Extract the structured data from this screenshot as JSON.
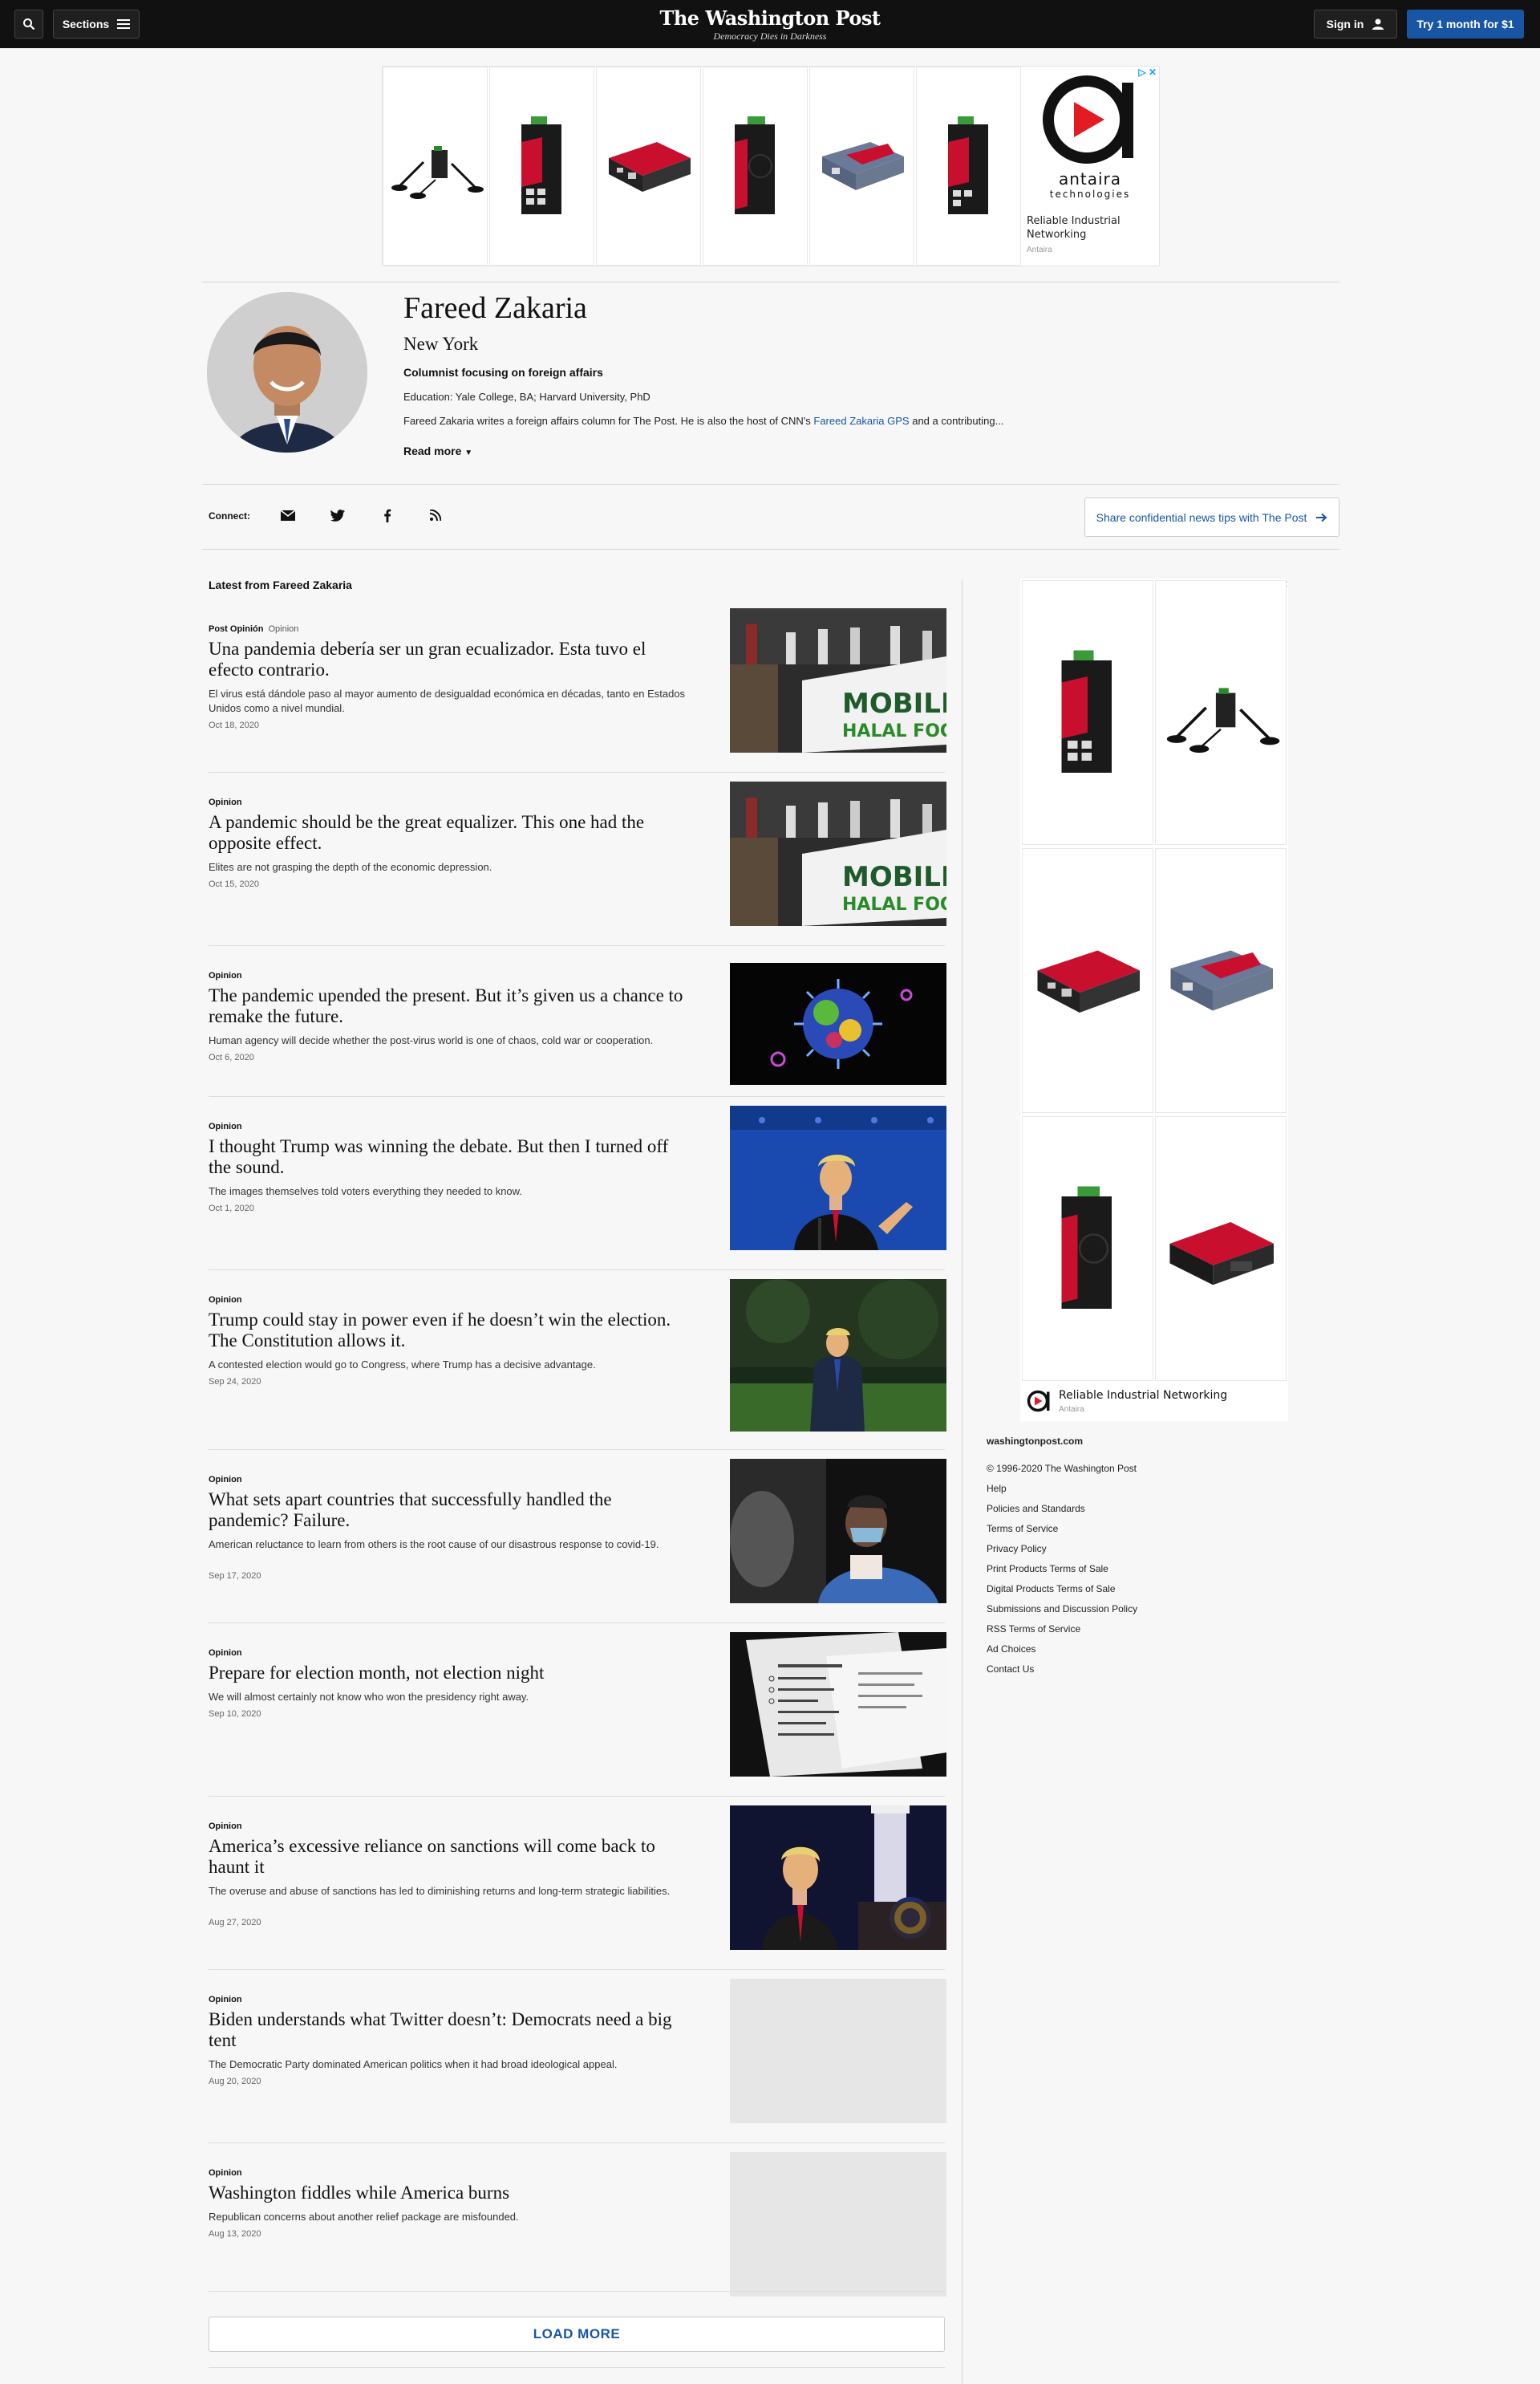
{
  "nav": {
    "sections_label": "Sections",
    "masthead": "The Washington Post",
    "tagline": "Democracy Dies in Darkness",
    "signin_label": "Sign in",
    "cta_label": "Try 1 month for $1"
  },
  "top_ad": {
    "brand_word": "antaira",
    "brand_sub": "technologies",
    "text": "Reliable Industrial Networking",
    "advertiser": "Antaira"
  },
  "profile": {
    "name": "Fareed Zakaria",
    "location": "New York",
    "role": "Columnist focusing on foreign affairs",
    "education": "Education: Yale College, BA; Harvard University, PhD",
    "bio_before": "Fareed Zakaria writes a foreign affairs column for The Post. He is also the host of CNN's ",
    "bio_link": "Fareed Zakaria GPS",
    "bio_after": " and a contributing...",
    "read_more": "Read more"
  },
  "connect": {
    "label": "Connect:",
    "tips_label": "Share confidential news tips with The Post"
  },
  "feed": {
    "title": "Latest from Fareed Zakaria",
    "articles": [
      {
        "kicker": "Post Opinión",
        "section": "Opinion",
        "headline": "Una pandemia debería ser un gran ecualizador. Esta tuvo el efecto contrario.",
        "blurb": "El virus está dándole paso al mayor aumento de desigualdad económica en décadas, tanto en Estados Unidos como a nivel mundial.",
        "date": "Oct 18, 2020"
      },
      {
        "kicker": "Opinion",
        "section": "",
        "headline": "A pandemic should be the great equalizer. This one had the opposite effect.",
        "blurb": "Elites are not grasping the depth of the economic depression.",
        "date": "Oct 15, 2020"
      },
      {
        "kicker": "Opinion",
        "section": "",
        "headline": "The pandemic upended the present. But it’s given us a chance to remake the future.",
        "blurb": "Human agency will decide whether the post-virus world is one of chaos, cold war or cooperation.",
        "date": "Oct 6, 2020"
      },
      {
        "kicker": "Opinion",
        "section": "",
        "headline": "I thought Trump was winning the debate. But then I turned off the sound.",
        "blurb": "The images themselves told voters everything they needed to know.",
        "date": "Oct 1, 2020"
      },
      {
        "kicker": "Opinion",
        "section": "",
        "headline": "Trump could stay in power even if he doesn’t win the election. The Constitution allows it.",
        "blurb": "A contested election would go to Congress, where Trump has a decisive advantage.",
        "date": "Sep 24, 2020"
      },
      {
        "kicker": "Opinion",
        "section": "",
        "headline": "What sets apart countries that successfully handled the pandemic? Failure.",
        "blurb": "American reluctance to learn from others is the root cause of our disastrous response to covid-19.",
        "date": "Sep 17, 2020"
      },
      {
        "kicker": "Opinion",
        "section": "",
        "headline": "Prepare for election month, not election night",
        "blurb": "We will almost certainly not know who won the presidency right away.",
        "date": "Sep 10, 2020"
      },
      {
        "kicker": "Opinion",
        "section": "",
        "headline": "America’s excessive reliance on sanctions will come back to haunt it",
        "blurb": "The overuse and abuse of sanctions has led to diminishing returns and long-term strategic liabilities.",
        "date": "Aug 27, 2020"
      },
      {
        "kicker": "Opinion",
        "section": "",
        "headline": "Biden understands what Twitter doesn’t: Democrats need a big tent",
        "blurb": "The Democratic Party dominated American politics when it had broad ideological appeal.",
        "date": "Aug 20, 2020"
      },
      {
        "kicker": "Opinion",
        "section": "",
        "headline": "Washington fiddles while America burns",
        "blurb": "Republican concerns about another relief package are misfounded.",
        "date": "Aug 13, 2020"
      }
    ],
    "load_more": "LOAD MORE"
  },
  "side_ad": {
    "text": "Reliable Industrial Networking",
    "advertiser": "Antaira"
  },
  "footer": {
    "site": "washingtonpost.com",
    "links": [
      "© 1996-2020 The Washington Post",
      "Help",
      "Policies and Standards",
      "Terms of Service",
      "Privacy Policy",
      "Print Products Terms of Sale",
      "Digital Products Terms of Sale",
      "Submissions and Discussion Policy",
      "RSS Terms of Service",
      "Ad Choices",
      "Contact Us"
    ]
  },
  "colors": {
    "nav_bg": "#111111",
    "accent": "#1955a5",
    "page_bg": "#f7f7f7"
  }
}
